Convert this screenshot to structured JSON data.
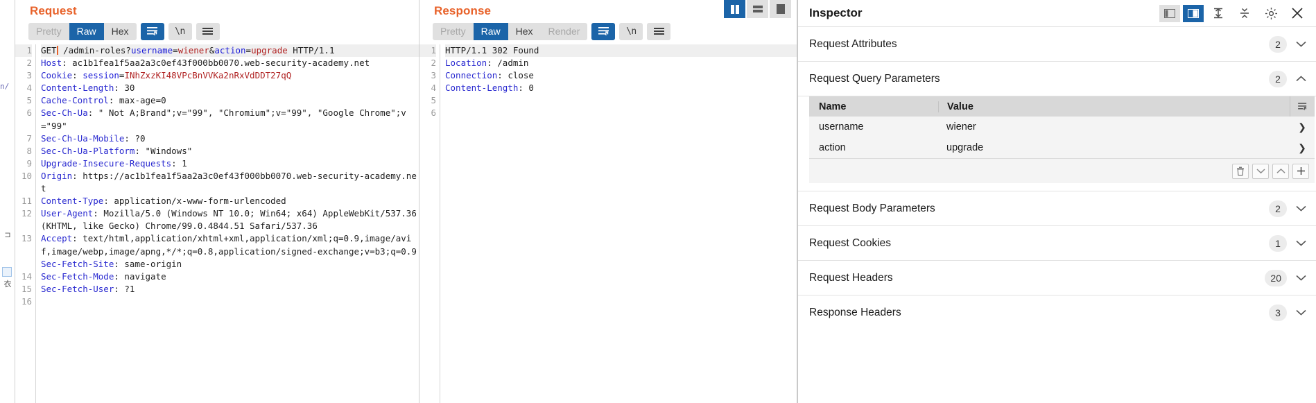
{
  "request": {
    "title": "Request",
    "tabs": [
      {
        "label": "Pretty",
        "state": "muted"
      },
      {
        "label": "Raw",
        "state": "active"
      },
      {
        "label": "Hex",
        "state": "normal"
      }
    ],
    "icons": {
      "wrap": "line-wrap-icon",
      "newline": "\\n",
      "menu": "hamburger-menu-icon"
    },
    "lines": [
      {
        "n": "1",
        "segs": [
          {
            "t": "GET",
            "c": "val"
          },
          {
            "t": "CARET",
            "c": "caret"
          },
          {
            "t": " /admin-roles?",
            "c": "val"
          },
          {
            "t": "username",
            "c": "pname"
          },
          {
            "t": "=",
            "c": "val"
          },
          {
            "t": "wiener",
            "c": "pval"
          },
          {
            "t": "&",
            "c": "val"
          },
          {
            "t": "action",
            "c": "pname"
          },
          {
            "t": "=",
            "c": "val"
          },
          {
            "t": "upgrade",
            "c": "pval"
          },
          {
            "t": " HTTP/1.1",
            "c": "val"
          }
        ],
        "highlight": true
      },
      {
        "n": "2",
        "segs": [
          {
            "t": "Host",
            "c": "hdr"
          },
          {
            "t": ": ac1b1fea1f5aa2a3c0ef43f000bb0070.web-security-academy.net",
            "c": "val"
          }
        ]
      },
      {
        "n": "3",
        "segs": [
          {
            "t": "Cookie",
            "c": "hdr"
          },
          {
            "t": ": ",
            "c": "val"
          },
          {
            "t": "session",
            "c": "pname"
          },
          {
            "t": "=",
            "c": "val"
          },
          {
            "t": "INhZxzKI48VPcBnVVKa2nRxVdDDT27qQ",
            "c": "pval"
          }
        ]
      },
      {
        "n": "4",
        "segs": [
          {
            "t": "Content-Length",
            "c": "hdr"
          },
          {
            "t": ": 30",
            "c": "val"
          }
        ]
      },
      {
        "n": "5",
        "segs": [
          {
            "t": "Cache-Control",
            "c": "hdr"
          },
          {
            "t": ": max-age=0",
            "c": "val"
          }
        ]
      },
      {
        "n": "6",
        "segs": [
          {
            "t": "Sec-Ch-Ua",
            "c": "hdr"
          },
          {
            "t": ": \" Not A;Brand\";v=\"99\", \"Chromium\";v=\"99\", \"Google Chrome\";v=\"99\"",
            "c": "val"
          }
        ]
      },
      {
        "n": "7",
        "segs": [
          {
            "t": "Sec-Ch-Ua-Mobile",
            "c": "hdr"
          },
          {
            "t": ": ?0",
            "c": "val"
          }
        ]
      },
      {
        "n": "8",
        "segs": [
          {
            "t": "Sec-Ch-Ua-Platform",
            "c": "hdr"
          },
          {
            "t": ": \"Windows\"",
            "c": "val"
          }
        ]
      },
      {
        "n": "9",
        "segs": [
          {
            "t": "Upgrade-Insecure-Requests",
            "c": "hdr"
          },
          {
            "t": ": 1",
            "c": "val"
          }
        ]
      },
      {
        "n": "10",
        "segs": [
          {
            "t": "Origin",
            "c": "hdr"
          },
          {
            "t": ": https://ac1b1fea1f5aa2a3c0ef43f000bb0070.web-security-academy.net",
            "c": "val"
          }
        ]
      },
      {
        "n": "11",
        "segs": [
          {
            "t": "Content-Type",
            "c": "hdr"
          },
          {
            "t": ": application/x-www-form-urlencoded",
            "c": "val"
          }
        ]
      },
      {
        "n": "12",
        "segs": [
          {
            "t": "User-Agent",
            "c": "hdr"
          },
          {
            "t": ": Mozilla/5.0 (Windows NT 10.0; Win64; x64) AppleWebKit/537.36 (KHTML, like Gecko) Chrome/99.0.4844.51 Safari/537.36",
            "c": "val"
          }
        ]
      },
      {
        "n": "13",
        "segs": [
          {
            "t": "Accept",
            "c": "hdr"
          },
          {
            "t": ": text/html,application/xhtml+xml,application/xml;q=0.9,image/avif,image/webp,image/apng,*/*;q=0.8,application/signed-exchange;v=b3;q=0.9",
            "c": "val"
          }
        ]
      },
      {
        "n": "14",
        "segs": [
          {
            "t": "Sec-Fetch-Site",
            "c": "hdr"
          },
          {
            "t": ": same-origin",
            "c": "val"
          }
        ]
      },
      {
        "n": "15",
        "segs": [
          {
            "t": "Sec-Fetch-Mode",
            "c": "hdr"
          },
          {
            "t": ": navigate",
            "c": "val"
          }
        ]
      },
      {
        "n": "16",
        "segs": [
          {
            "t": "Sec-Fetch-User",
            "c": "hdr"
          },
          {
            "t": ": ?1",
            "c": "val"
          }
        ]
      }
    ]
  },
  "response": {
    "title": "Response",
    "tabs": [
      {
        "label": "Pretty",
        "state": "muted"
      },
      {
        "label": "Raw",
        "state": "active"
      },
      {
        "label": "Hex",
        "state": "normal"
      },
      {
        "label": "Render",
        "state": "muted"
      }
    ],
    "icons": {
      "wrap": "line-wrap-icon",
      "newline": "\\n",
      "menu": "hamburger-menu-icon"
    },
    "lines": [
      {
        "n": "1",
        "segs": [
          {
            "t": "HTTP/1.1 302 Found",
            "c": "val"
          }
        ],
        "highlight": true
      },
      {
        "n": "2",
        "segs": [
          {
            "t": "Location",
            "c": "hdr"
          },
          {
            "t": ": /admin",
            "c": "val"
          }
        ]
      },
      {
        "n": "3",
        "segs": [
          {
            "t": "Connection",
            "c": "hdr"
          },
          {
            "t": ": close",
            "c": "val"
          }
        ]
      },
      {
        "n": "4",
        "segs": [
          {
            "t": "Content-Length",
            "c": "hdr"
          },
          {
            "t": ": 0",
            "c": "val"
          }
        ]
      },
      {
        "n": "5",
        "segs": [
          {
            "t": "",
            "c": "val"
          }
        ]
      },
      {
        "n": "6",
        "segs": [
          {
            "t": "",
            "c": "val"
          }
        ]
      }
    ]
  },
  "layout_switch": {
    "buttons": [
      {
        "name": "layout-vertical-split-button",
        "state": "active"
      },
      {
        "name": "layout-horizontal-split-button",
        "state": "normal"
      },
      {
        "name": "layout-tabbed-button",
        "state": "normal"
      }
    ]
  },
  "inspector": {
    "title": "Inspector",
    "header_buttons": [
      {
        "name": "inspector-left-dock-button",
        "state": "normal"
      },
      {
        "name": "inspector-right-dock-button",
        "state": "active"
      },
      {
        "name": "expand-all-button",
        "state": "plain"
      },
      {
        "name": "collapse-all-button",
        "state": "plain"
      },
      {
        "name": "settings-gear-button",
        "state": "plain"
      },
      {
        "name": "close-button",
        "state": "plain"
      }
    ],
    "sections": [
      {
        "label": "Request Attributes",
        "count": "2",
        "expanded": false
      },
      {
        "label": "Request Query Parameters",
        "count": "2",
        "expanded": true
      },
      {
        "label": "Request Body Parameters",
        "count": "2",
        "expanded": false
      },
      {
        "label": "Request Cookies",
        "count": "1",
        "expanded": false
      },
      {
        "label": "Request Headers",
        "count": "20",
        "expanded": false
      },
      {
        "label": "Response Headers",
        "count": "3",
        "expanded": false
      }
    ],
    "query_table": {
      "columns": [
        "Name",
        "Value"
      ],
      "rows": [
        {
          "name": "username",
          "value": "wiener"
        },
        {
          "name": "action",
          "value": "upgrade"
        }
      ],
      "tools": [
        "delete-icon",
        "move-down-icon",
        "move-up-icon",
        "add-icon"
      ]
    }
  },
  "colors": {
    "accent_orange": "#e8622a",
    "accent_blue": "#1b64a8",
    "header_blue": "#2a2ad0",
    "param_value_red": "#b02222"
  }
}
